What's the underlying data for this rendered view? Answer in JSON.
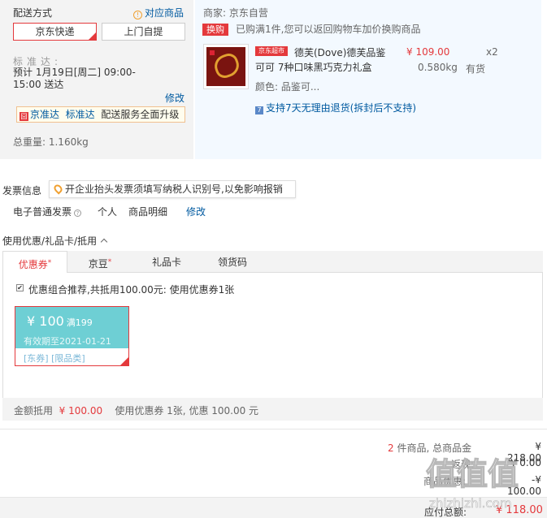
{
  "shipping": {
    "title": "配送方式",
    "match_link": "对应商品",
    "options": [
      "京东快递",
      "上门自提"
    ],
    "std_label": "标准达:",
    "std_time": "预计 1月19日[周二] 09:00-15:00 送达",
    "edit": "修改",
    "jzd_icon": "囧",
    "jzd_link1": "京准达",
    "jzd_link2": "标准达",
    "jzd_text": "配送服务全面升级",
    "total_weight": "总重量: 1.160kg"
  },
  "product_panel": {
    "merchant": "商家: 京东自营",
    "swap_badge": "换购",
    "swap_text": "已购满1件,您可以返回购物车加价换购商品",
    "jd_market_tag": "京东超市",
    "name": "德芙(Dove)德芙品鉴可可 7种口味黑巧克力礼盒",
    "price": "¥ 109.00",
    "qty": "x2",
    "weight": "0.580kg",
    "stock": "有货",
    "color": "颜色: 品鉴可...",
    "return_icon": "7",
    "return_policy": "支持7天无理由退货(拆封后不支持)"
  },
  "invoice": {
    "title": "发票信息",
    "tip": "开企业抬头发票须填写纳税人识别号,以免影响报销",
    "type": "电子普通发票",
    "person": "个人",
    "detail": "商品明细",
    "edit": "修改"
  },
  "coupons": {
    "title": "使用优惠/礼品卡/抵用",
    "tabs": [
      {
        "label": "优惠券",
        "mark": "*"
      },
      {
        "label": "京豆",
        "mark": "*"
      },
      {
        "label": "礼品卡",
        "mark": ""
      },
      {
        "label": "领货码",
        "mark": ""
      }
    ],
    "combo_text": "优惠组合推荐,共抵用100.00元: 使用优惠券1张",
    "combo_checked": "✔",
    "card": {
      "amount": "¥ 100",
      "min": "满199",
      "expire": "有效期至2021-01-21",
      "tags": "[东券] [限品类]"
    },
    "deduct_label": "金额抵用",
    "deduct_amount": "¥ 100.00",
    "deduct_desc": "使用优惠券 1张, 优惠 100.00 元"
  },
  "summary": {
    "count": "2",
    "label1": "件商品, 总商品金",
    "value1": "¥ 218.00",
    "label2": "返现:",
    "value2": "¥ 0.00",
    "label3": "商品优惠:",
    "value3": "-¥ 100.00",
    "total_label": "应付总额:",
    "total_value": "¥ 118.00"
  },
  "watermark": {
    "text": "值值值",
    "url": "zhizhizhi.com"
  },
  "colors": {
    "accent_red": "#e4393c",
    "link_blue": "#005aa0",
    "coupon_teal": "#6ecfd4"
  }
}
